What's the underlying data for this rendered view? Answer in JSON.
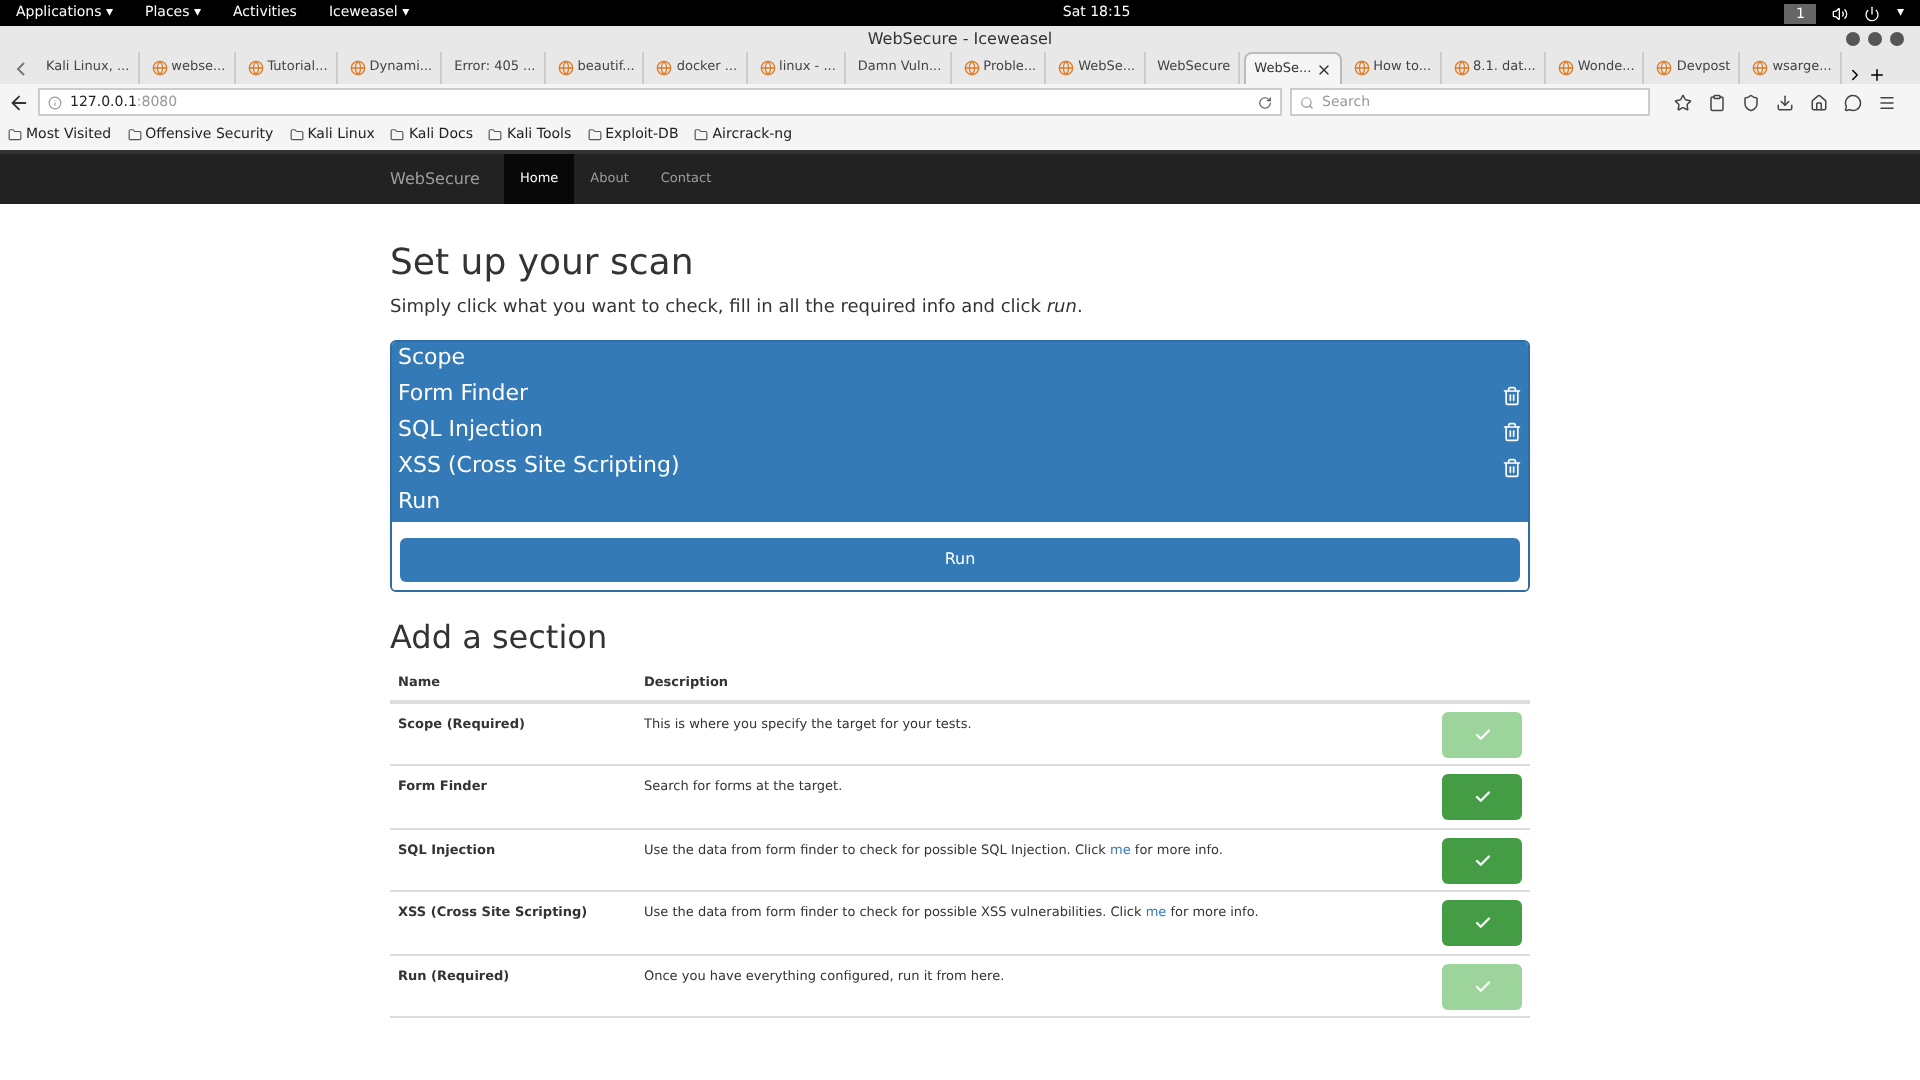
{
  "top_bar": {
    "menus": [
      "Applications ▾",
      "Places ▾",
      "Activities",
      "Iceweasel ▾"
    ],
    "clock": "Sat 18:15",
    "workspace": "1",
    "power": "▾"
  },
  "window": {
    "title": "WebSecure - Iceweasel"
  },
  "tabs": [
    {
      "label": "Kali Linux, ...",
      "selected": false,
      "kind": "plain"
    },
    {
      "label": "webse...",
      "selected": false,
      "kind": "icon"
    },
    {
      "label": "Tutorial...",
      "selected": false,
      "kind": "icon"
    },
    {
      "label": "Dynami...",
      "selected": false,
      "kind": "icon"
    },
    {
      "label": "Error: 405 ...",
      "selected": false,
      "kind": "plain"
    },
    {
      "label": "beautif...",
      "selected": false,
      "kind": "icon"
    },
    {
      "label": "docker ...",
      "selected": false,
      "kind": "icon"
    },
    {
      "label": "linux - ...",
      "selected": false,
      "kind": "icon"
    },
    {
      "label": "Damn Vuln...",
      "selected": false,
      "kind": "plain"
    },
    {
      "label": "Proble...",
      "selected": false,
      "kind": "icon"
    },
    {
      "label": "WebSe...",
      "selected": false,
      "kind": "icon"
    },
    {
      "label": "WebSecure",
      "selected": false,
      "kind": "plain"
    },
    {
      "label": "WebSe...",
      "selected": true,
      "kind": "plain"
    },
    {
      "label": "How to...",
      "selected": false,
      "kind": "icon"
    },
    {
      "label": "8.1. dat...",
      "selected": false,
      "kind": "icon"
    },
    {
      "label": "Wonde...",
      "selected": false,
      "kind": "icon"
    },
    {
      "label": "Devpost",
      "selected": false,
      "kind": "icon"
    },
    {
      "label": "wsarge...",
      "selected": false,
      "kind": "icon"
    }
  ],
  "address": {
    "host": "127.0.0.1",
    "port": ":8080"
  },
  "search": {
    "placeholder": "Search"
  },
  "bookmarks": [
    "Most Visited",
    "Offensive Security",
    "Kali Linux",
    "Kali Docs",
    "Kali Tools",
    "Exploit-DB",
    "Aircrack-ng"
  ],
  "site_nav": {
    "brand": "WebSecure",
    "links": [
      {
        "label": "Home",
        "selected": true
      },
      {
        "label": "About",
        "selected": false
      },
      {
        "label": "Contact",
        "selected": false
      }
    ]
  },
  "heading": "Set up your scan",
  "intro": "Simply click what you want to check, fill in all the required info and click *run*.",
  "scan_list": [
    {
      "label": "Scope",
      "removable": false
    },
    {
      "label": "Form Finder",
      "removable": true
    },
    {
      "label": "SQL Injection",
      "removable": true
    },
    {
      "label": "XSS (Cross Site Scripting)",
      "removable": true
    },
    {
      "label": "Run",
      "removable": false
    }
  ],
  "run_button": "Run",
  "add_heading": "Add a section",
  "table": {
    "columns": [
      "Name",
      "Description"
    ],
    "rows": [
      {
        "name": "Scope (Required)",
        "description": "This is where you specify the target for your tests.",
        "disabled": true
      },
      {
        "name": "Form Finder",
        "description": "Search for forms at the target.",
        "disabled": false
      },
      {
        "name": "SQL Injection",
        "description": "Use the data from form finder to check for possible SQL Injection. Click ",
        "link": "me",
        "after": " for more info.",
        "disabled": false
      },
      {
        "name": "XSS (Cross Site Scripting)",
        "description": "Use the data from form finder to check for possible XSS vulnerabilities. Click ",
        "link": "me",
        "after": " for more info.",
        "disabled": false
      },
      {
        "name": "Run (Required)",
        "description": "Once you have everything configured, run it from here.",
        "disabled": true
      }
    ]
  }
}
